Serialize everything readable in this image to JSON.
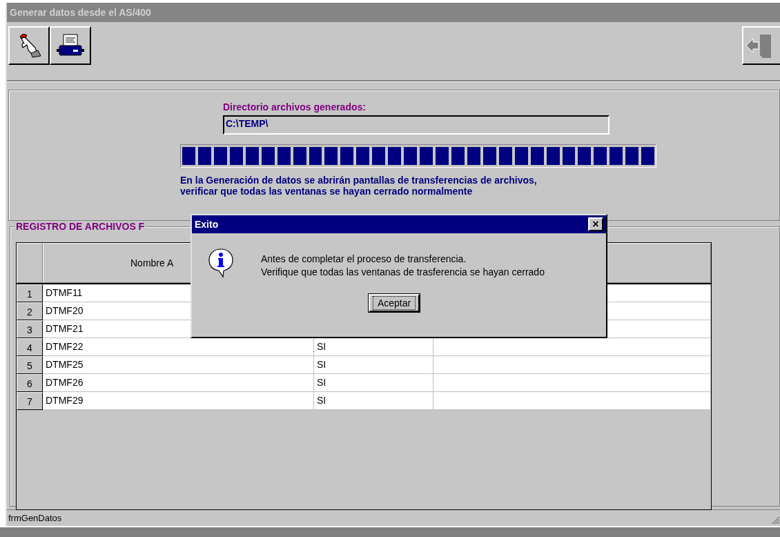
{
  "window": {
    "title": "Generar datos desde el AS/400"
  },
  "toolbar": {
    "buttons": [
      {
        "kind": "hand"
      },
      {
        "kind": "printer"
      }
    ],
    "exit_button": {
      "kind": "exit"
    }
  },
  "directory": {
    "label": "Directorio archivos generados:",
    "value": "C:\\TEMP\\"
  },
  "progress": {
    "level": 1
  },
  "notice": [
    "En la Generación de datos se abrirán pantallas de transferencias de archivos,",
    "verificar que todas las ventanas se hayan cerrado normalmente"
  ],
  "group": {
    "title": "REGISTRO DE ARCHIVOS F",
    "columns": [
      "Nombre A"
    ],
    "rows": [
      {
        "number": "1",
        "name": "DTMF11"
      },
      {
        "number": "2",
        "name": "DTMF20"
      },
      {
        "number": "3",
        "name": "DTMF21"
      },
      {
        "number": "4",
        "name": "DTMF22",
        "column_2": "SI"
      },
      {
        "number": "5",
        "name": "DTMF25",
        "column_2": "SI"
      },
      {
        "number": "6",
        "name": "DTMF26",
        "column_2": "SI"
      },
      {
        "number": "7",
        "name": "DTMF29",
        "column_2": "SI"
      }
    ]
  },
  "dialog": {
    "title": "Exito",
    "close": "×",
    "message": [
      "Antes de completar el proceso de transferencia.",
      "Verifique que todas las ventanas de trasferencia se hayan cerrado"
    ],
    "button": "Aceptar"
  },
  "status_bar": {
    "text": "frmGenDatos"
  }
}
